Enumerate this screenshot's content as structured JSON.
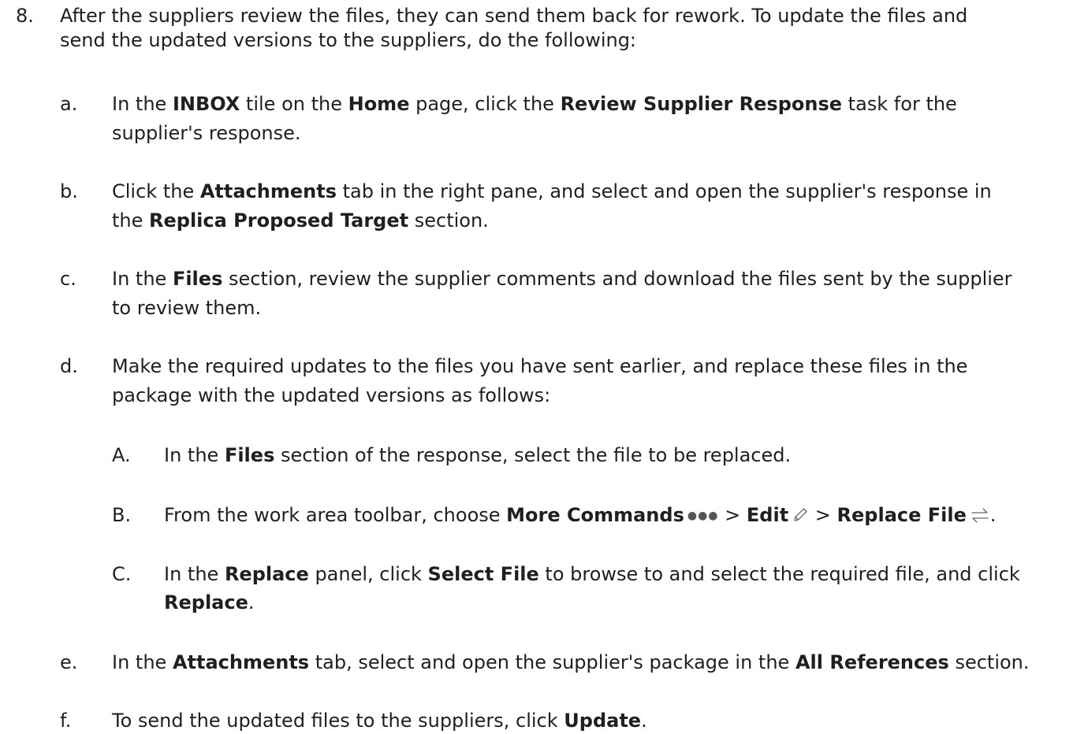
{
  "step": {
    "number": "8.",
    "line1": "After the suppliers review the files, they can send them back for rework. To update the files and",
    "line2": "send the updated versions to the suppliers, do the following:"
  },
  "substeps": {
    "a": {
      "marker": "a.",
      "t1": "In the ",
      "b1": "INBOX",
      "t2": " tile on the ",
      "b2": "Home",
      "t3": " page, click the ",
      "b3": "Review Supplier Response",
      "t4": " task for the",
      "line2": "supplier's response."
    },
    "b": {
      "marker": "b.",
      "t1": "Click the ",
      "b1": "Attachments",
      "t2": " tab in the right pane, and select and open the supplier's response in",
      "l2t1": "the ",
      "l2b1": "Replica Proposed Target",
      "l2t2": " section."
    },
    "c": {
      "marker": "c.",
      "t1": "In the ",
      "b1": "Files",
      "t2": " section, review the supplier comments and download the files sent by the supplier",
      "line2": "to review them."
    },
    "d": {
      "marker": "d.",
      "line1": "Make the required updates to the files you have sent earlier, and replace these files in the",
      "line2": "package with the updated versions as follows:",
      "subitems": {
        "A": {
          "marker": "A.",
          "t1": "In the ",
          "b1": "Files",
          "t2": " section of the response, select the file to be replaced."
        },
        "B": {
          "marker": "B.",
          "t1": "From the work area toolbar, choose ",
          "b1": "More Commands",
          "sep1": " > ",
          "b2": "Edit",
          "sep2": " > ",
          "b3": "Replace File",
          "end": "."
        },
        "C": {
          "marker": "C.",
          "t1": "In the ",
          "b1": "Replace",
          "t2": " panel, click ",
          "b2": "Select File",
          "t3": " to browse to and select the required file, and click",
          "l2b1": "Replace",
          "l2end": "."
        }
      }
    },
    "e": {
      "marker": "e.",
      "t1": "In the ",
      "b1": "Attachments",
      "t2": " tab, select and open the supplier's package in the ",
      "b2": "All References",
      "t3": " section."
    },
    "f": {
      "marker": "f.",
      "t1": "To send the updated files to the suppliers, click ",
      "b1": "Update",
      "end": "."
    }
  },
  "icons": {
    "more_commands": "more-commands-icon",
    "edit": "pencil-icon",
    "replace_file": "replace-file-icon"
  },
  "colors": {
    "text": "#1f1f1f",
    "icon": "#666666"
  }
}
